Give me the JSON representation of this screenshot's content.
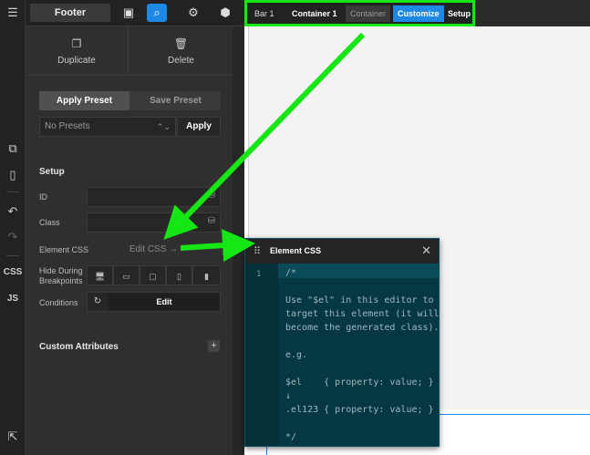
{
  "topbar": {
    "context_label": "Footer",
    "icons": [
      "panel-toggle-icon",
      "search-icon",
      "gear-icon",
      "logo-badge-icon"
    ]
  },
  "breadcrumb": {
    "items": [
      "Bar 1",
      "Container 1",
      "Container",
      "Customize",
      "Setup"
    ]
  },
  "actions": {
    "duplicate": "Duplicate",
    "delete": "Delete"
  },
  "presets": {
    "apply_tab": "Apply Preset",
    "save_tab": "Save Preset",
    "select_value": "No Presets",
    "apply_button": "Apply"
  },
  "setup": {
    "title": "Setup",
    "id_label": "ID",
    "class_label": "Class",
    "element_css_label": "Element CSS",
    "edit_css_link": "Edit CSS →",
    "hide_label": "Hide During Breakpoints",
    "conditions_label": "Conditions",
    "conditions_edit": "Edit"
  },
  "custom_attributes": {
    "title": "Custom Attributes",
    "add": "+"
  },
  "rail": {
    "css": "CSS",
    "js": "JS"
  },
  "modal": {
    "title": "Element CSS",
    "close": "✕",
    "line_number": "1",
    "code_lines": [
      "/*",
      "",
      "Use \"$el\" in this editor to",
      "target this element (it will",
      "become the generated class).",
      "",
      "e.g.",
      "",
      "$el    { property: value; }",
      "↓",
      ".el123 { property: value; }",
      "",
      "*/"
    ]
  },
  "colors": {
    "accent": "#1e88e5",
    "highlight": "#16e616",
    "editor_bg": "#063844"
  }
}
